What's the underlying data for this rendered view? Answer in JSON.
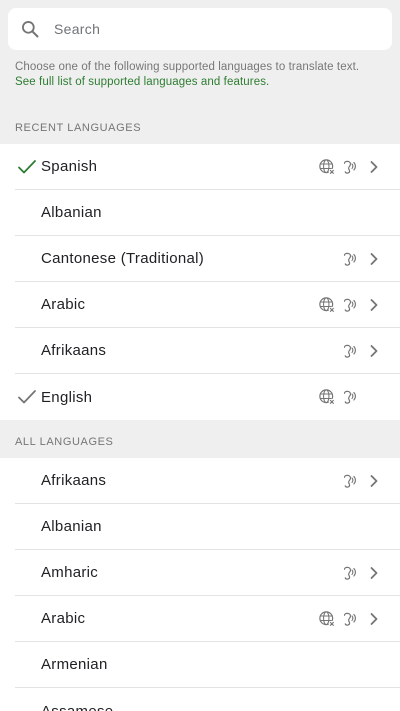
{
  "search": {
    "placeholder": "Search"
  },
  "info": {
    "text": "Choose one of the following supported languages to translate text.",
    "link": "See full list of supported languages and features."
  },
  "sections": {
    "recent": "RECENT LANGUAGES",
    "all": "ALL LANGUAGES"
  },
  "recent_languages": [
    {
      "label": "Spanish",
      "check": "green",
      "globe": true,
      "speaker": true,
      "chevron": true
    },
    {
      "label": "Albanian",
      "check": "",
      "globe": false,
      "speaker": false,
      "chevron": false
    },
    {
      "label": "Cantonese (Traditional)",
      "check": "",
      "globe": false,
      "speaker": true,
      "chevron": true
    },
    {
      "label": "Arabic",
      "check": "",
      "globe": true,
      "speaker": true,
      "chevron": true
    },
    {
      "label": "Afrikaans",
      "check": "",
      "globe": false,
      "speaker": true,
      "chevron": true
    },
    {
      "label": "English",
      "check": "gray",
      "globe": true,
      "speaker": true,
      "chevron": false
    }
  ],
  "all_languages": [
    {
      "label": "Afrikaans",
      "check": "",
      "globe": false,
      "speaker": true,
      "chevron": true
    },
    {
      "label": "Albanian",
      "check": "",
      "globe": false,
      "speaker": false,
      "chevron": false
    },
    {
      "label": "Amharic",
      "check": "",
      "globe": false,
      "speaker": true,
      "chevron": true
    },
    {
      "label": "Arabic",
      "check": "",
      "globe": true,
      "speaker": true,
      "chevron": true
    },
    {
      "label": "Armenian",
      "check": "",
      "globe": false,
      "speaker": false,
      "chevron": false
    },
    {
      "label": "Assamese",
      "check": "",
      "globe": false,
      "speaker": false,
      "chevron": false
    }
  ],
  "colors": {
    "check_green": "#2e7d32",
    "check_gray": "#757575",
    "icon_gray": "#757575",
    "link_green": "#2e7d32"
  }
}
